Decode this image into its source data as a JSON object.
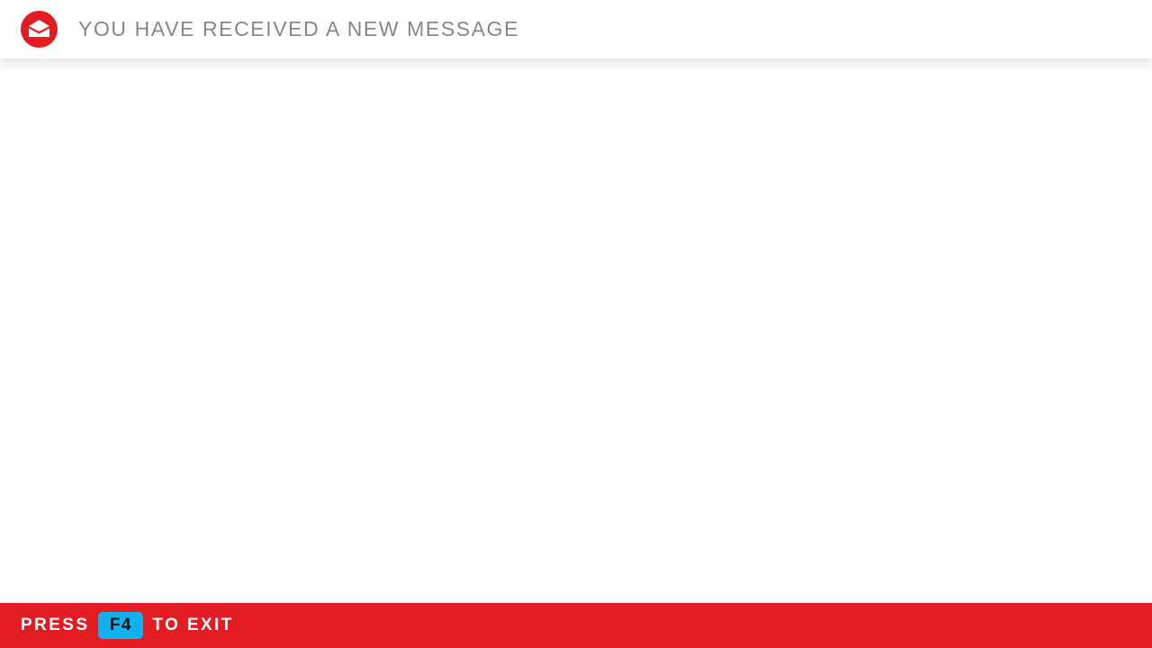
{
  "header": {
    "title": "YOU HAVE RECEIVED A NEW MESSAGE",
    "icon": "envelope-icon"
  },
  "footer": {
    "prefix": "PRESS",
    "key": "F4",
    "suffix": "TO EXIT"
  },
  "colors": {
    "brand_red": "#e31c23",
    "key_blue": "#0fb2ef",
    "title_gray": "#878787"
  }
}
